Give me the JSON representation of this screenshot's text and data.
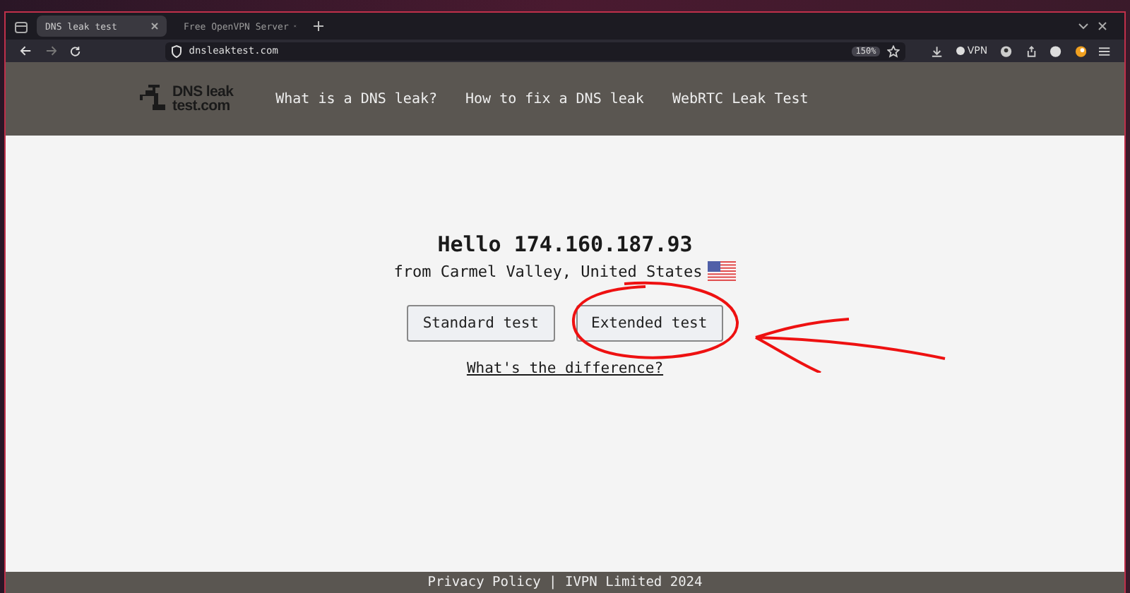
{
  "browser": {
    "tabs": [
      {
        "title": "DNS leak test",
        "selected": true
      },
      {
        "title": "Free OpenVPN Server",
        "selected": false
      }
    ],
    "address": "dnsleaktest.com",
    "zoom": "150%",
    "vpn_label": "VPN"
  },
  "site": {
    "logo_line_1": "DNS leak",
    "logo_line_2": "test.com",
    "nav": [
      "What is a DNS leak?",
      "How to fix a DNS leak",
      "WebRTC Leak Test"
    ],
    "greeting": "Hello 174.160.187.93",
    "location": "from Carmel Valley, United States",
    "buttons": [
      "Standard test",
      "Extended test"
    ],
    "difference_link": "What's the difference?",
    "footer": "Privacy Policy | IVPN Limited 2024"
  }
}
